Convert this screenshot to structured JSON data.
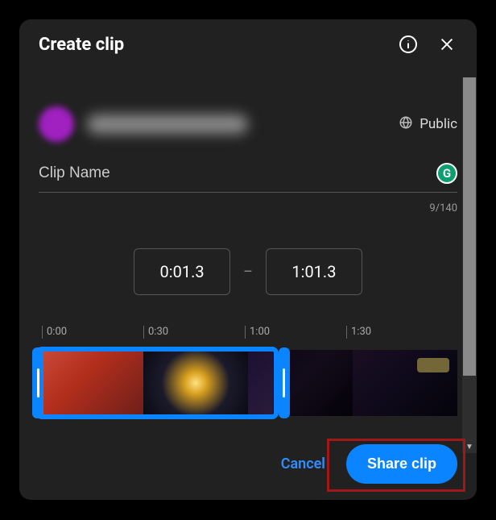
{
  "header": {
    "title": "Create clip"
  },
  "user": {
    "visibility_label": "Public"
  },
  "input": {
    "placeholder": "Clip Name",
    "value": "",
    "counter": "9/140",
    "extension_badge": "G"
  },
  "time": {
    "start": "0:01.3",
    "end": "1:01.3",
    "separator": "–"
  },
  "timeline": {
    "ticks": [
      "0:00",
      "0:30",
      "1:00",
      "1:30"
    ]
  },
  "actions": {
    "cancel": "Cancel",
    "share": "Share clip"
  },
  "colors": {
    "accent": "#0a84ff"
  }
}
